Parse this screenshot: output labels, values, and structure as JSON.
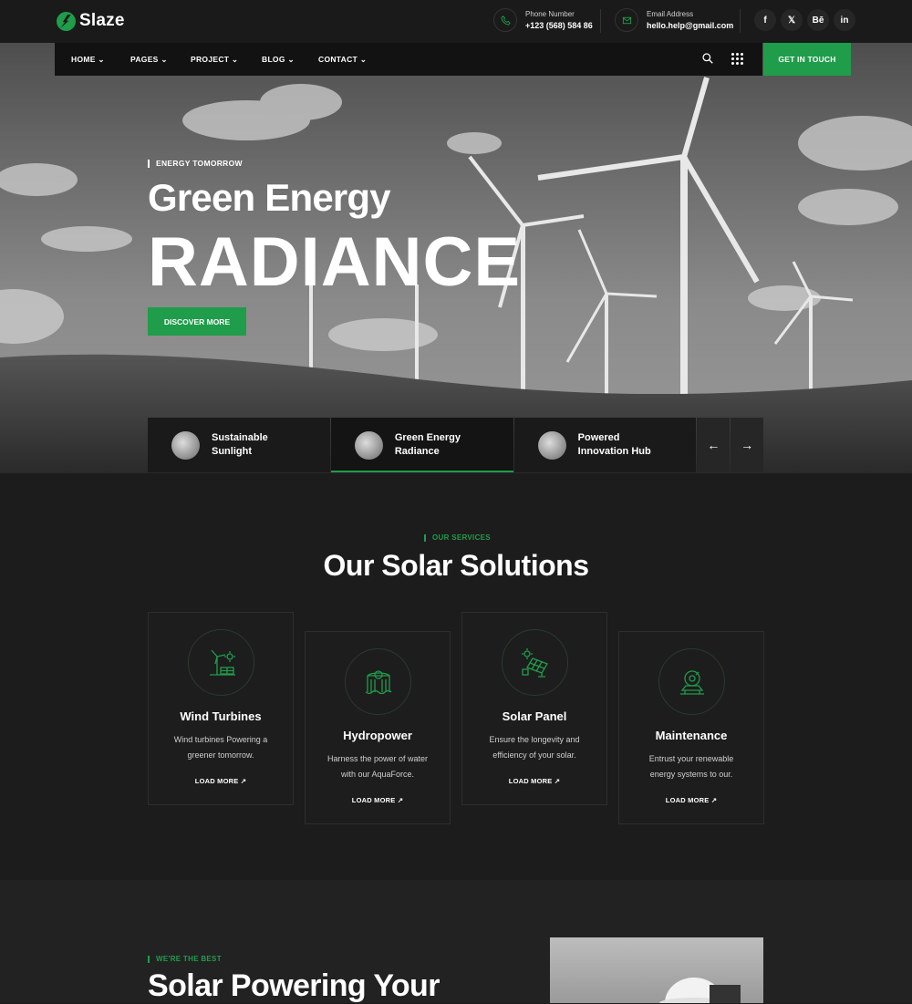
{
  "brand": {
    "name": "Slaze",
    "accent": "#1f9d4a"
  },
  "topbar": {
    "phone_label": "Phone Number",
    "phone_value": "+123 (568) 584 86",
    "email_label": "Email Address",
    "email_value": "hello.help@gmail.com",
    "socials": [
      "f",
      "𝕏",
      "Bē",
      "in"
    ]
  },
  "nav": {
    "items": [
      "HOME",
      "PAGES",
      "PROJECT",
      "BLOG",
      "CONTACT"
    ],
    "cta": "GET IN TOUCH"
  },
  "hero": {
    "eyebrow": "ENERGY TOMORROW",
    "line1": "Green Energy",
    "line2": "RADIANCE",
    "button": "DISCOVER MORE",
    "slides": [
      "Sustainable Sunlight",
      "Green Energy Radiance",
      "Powered Innovation Hub"
    ],
    "active_slide": 1,
    "prev": "←",
    "next": "→"
  },
  "services": {
    "eyebrow": "OUR SERVICES",
    "title": "Our Solar Solutions",
    "cards": [
      {
        "icon": "wind-turbine-icon",
        "title": "Wind Turbines",
        "text": "Wind turbines Powering a greener tomorrow.",
        "link": "LOAD MORE ↗"
      },
      {
        "icon": "hydropower-icon",
        "title": "Hydropower",
        "text": "Harness the power of water with our AquaForce.",
        "link": "LOAD MORE ↗"
      },
      {
        "icon": "solar-panel-icon",
        "title": "Solar Panel",
        "text": "Ensure the longevity and efficiency of your solar.",
        "link": "LOAD MORE ↗"
      },
      {
        "icon": "maintenance-icon",
        "title": "Maintenance",
        "text": "Entrust your renewable energy systems to our.",
        "link": "LOAD MORE ↗"
      }
    ]
  },
  "about": {
    "eyebrow": "WE'RE THE BEST",
    "title": "Solar Powering Your"
  }
}
